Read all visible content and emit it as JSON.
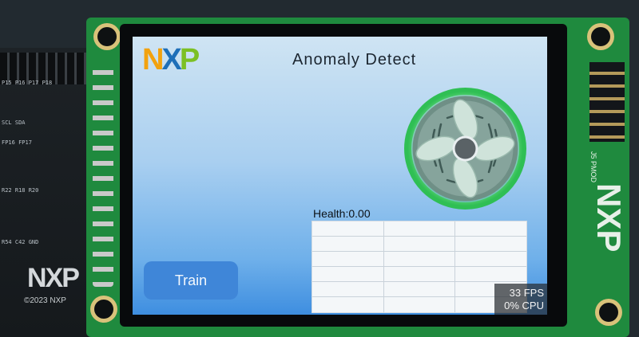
{
  "screen": {
    "logo": {
      "n": "N",
      "x": "X",
      "p": "P"
    },
    "title": "Anomaly Detect",
    "fan_icon": "fan-icon",
    "health": "Health:0.00",
    "train_label": "Train",
    "fps": "33 FPS",
    "cpu": "0% CPU"
  },
  "board": {
    "logo": "NXP",
    "copyright": "©2023 NXP",
    "silk": [
      "P15 P16 P17 P18",
      "SCL SDA",
      "FP16 FP17",
      "R22 R18 R20",
      "R54 C42 GND"
    ],
    "pcb_logo": "NXP",
    "pmod_label": "J5 PMOD"
  },
  "colors": {
    "nxp_orange": "#f2a20e",
    "nxp_blue": "#1e6fb8",
    "nxp_green": "#7cc024",
    "button": "#3f86d8",
    "fan_ring": "#44d86a"
  }
}
